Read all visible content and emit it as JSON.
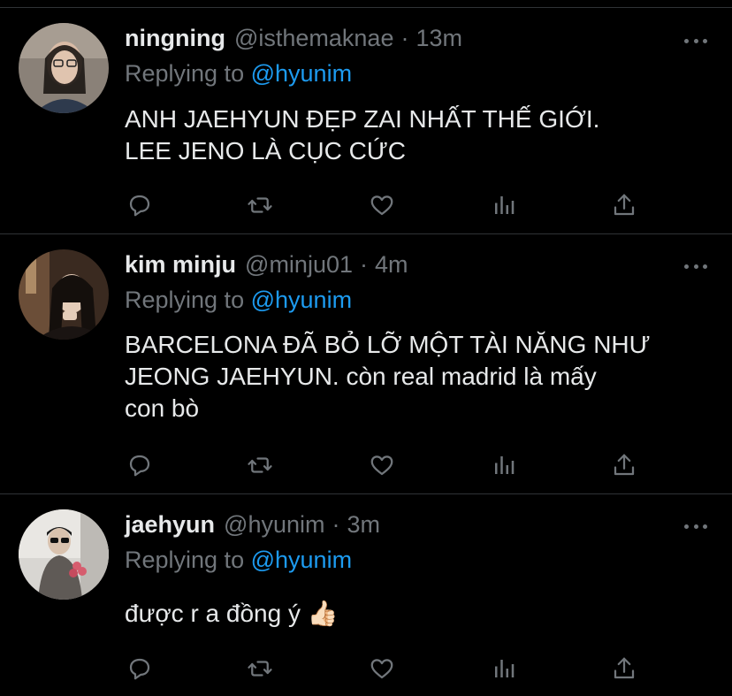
{
  "colors": {
    "background": "#000000",
    "text": "#e7e9ea",
    "muted": "#71767b",
    "accent": "#1d9bf0",
    "divider": "#2f3336"
  },
  "tweets": [
    {
      "name": "ningning",
      "handle": "@isthemaknae",
      "separator": "·",
      "time": "13m",
      "replying_prefix": "Replying to",
      "replying_to": "@hyunim",
      "lines": [
        "ANH JAEHYUN ĐẸP ZAI NHẤT THẾ GIỚI.",
        "LEE JENO LÀ CỤC CỨC"
      ],
      "avatar_icon": "user-photo-avatar"
    },
    {
      "name": "kim minju",
      "handle": "@minju01",
      "separator": "·",
      "time": "4m",
      "replying_prefix": "Replying to",
      "replying_to": "@hyunim",
      "lines": [
        "BARCELONA ĐÃ BỎ LỠ MỘT TÀI NĂNG NHƯ",
        "JEONG JAEHYUN. còn real madrid là mấy",
        "con bò"
      ],
      "avatar_icon": "user-photo-avatar"
    },
    {
      "name": "jaehyun",
      "handle": "@hyunim",
      "separator": "·",
      "time": "3m",
      "replying_prefix": "Replying to",
      "replying_to": "@hyunim",
      "lines": [
        "được r a đồng ý 👍🏻"
      ],
      "avatar_icon": "user-photo-avatar"
    }
  ],
  "action_icons": [
    "reply-icon",
    "retweet-icon",
    "like-icon",
    "analytics-icon",
    "share-icon"
  ]
}
